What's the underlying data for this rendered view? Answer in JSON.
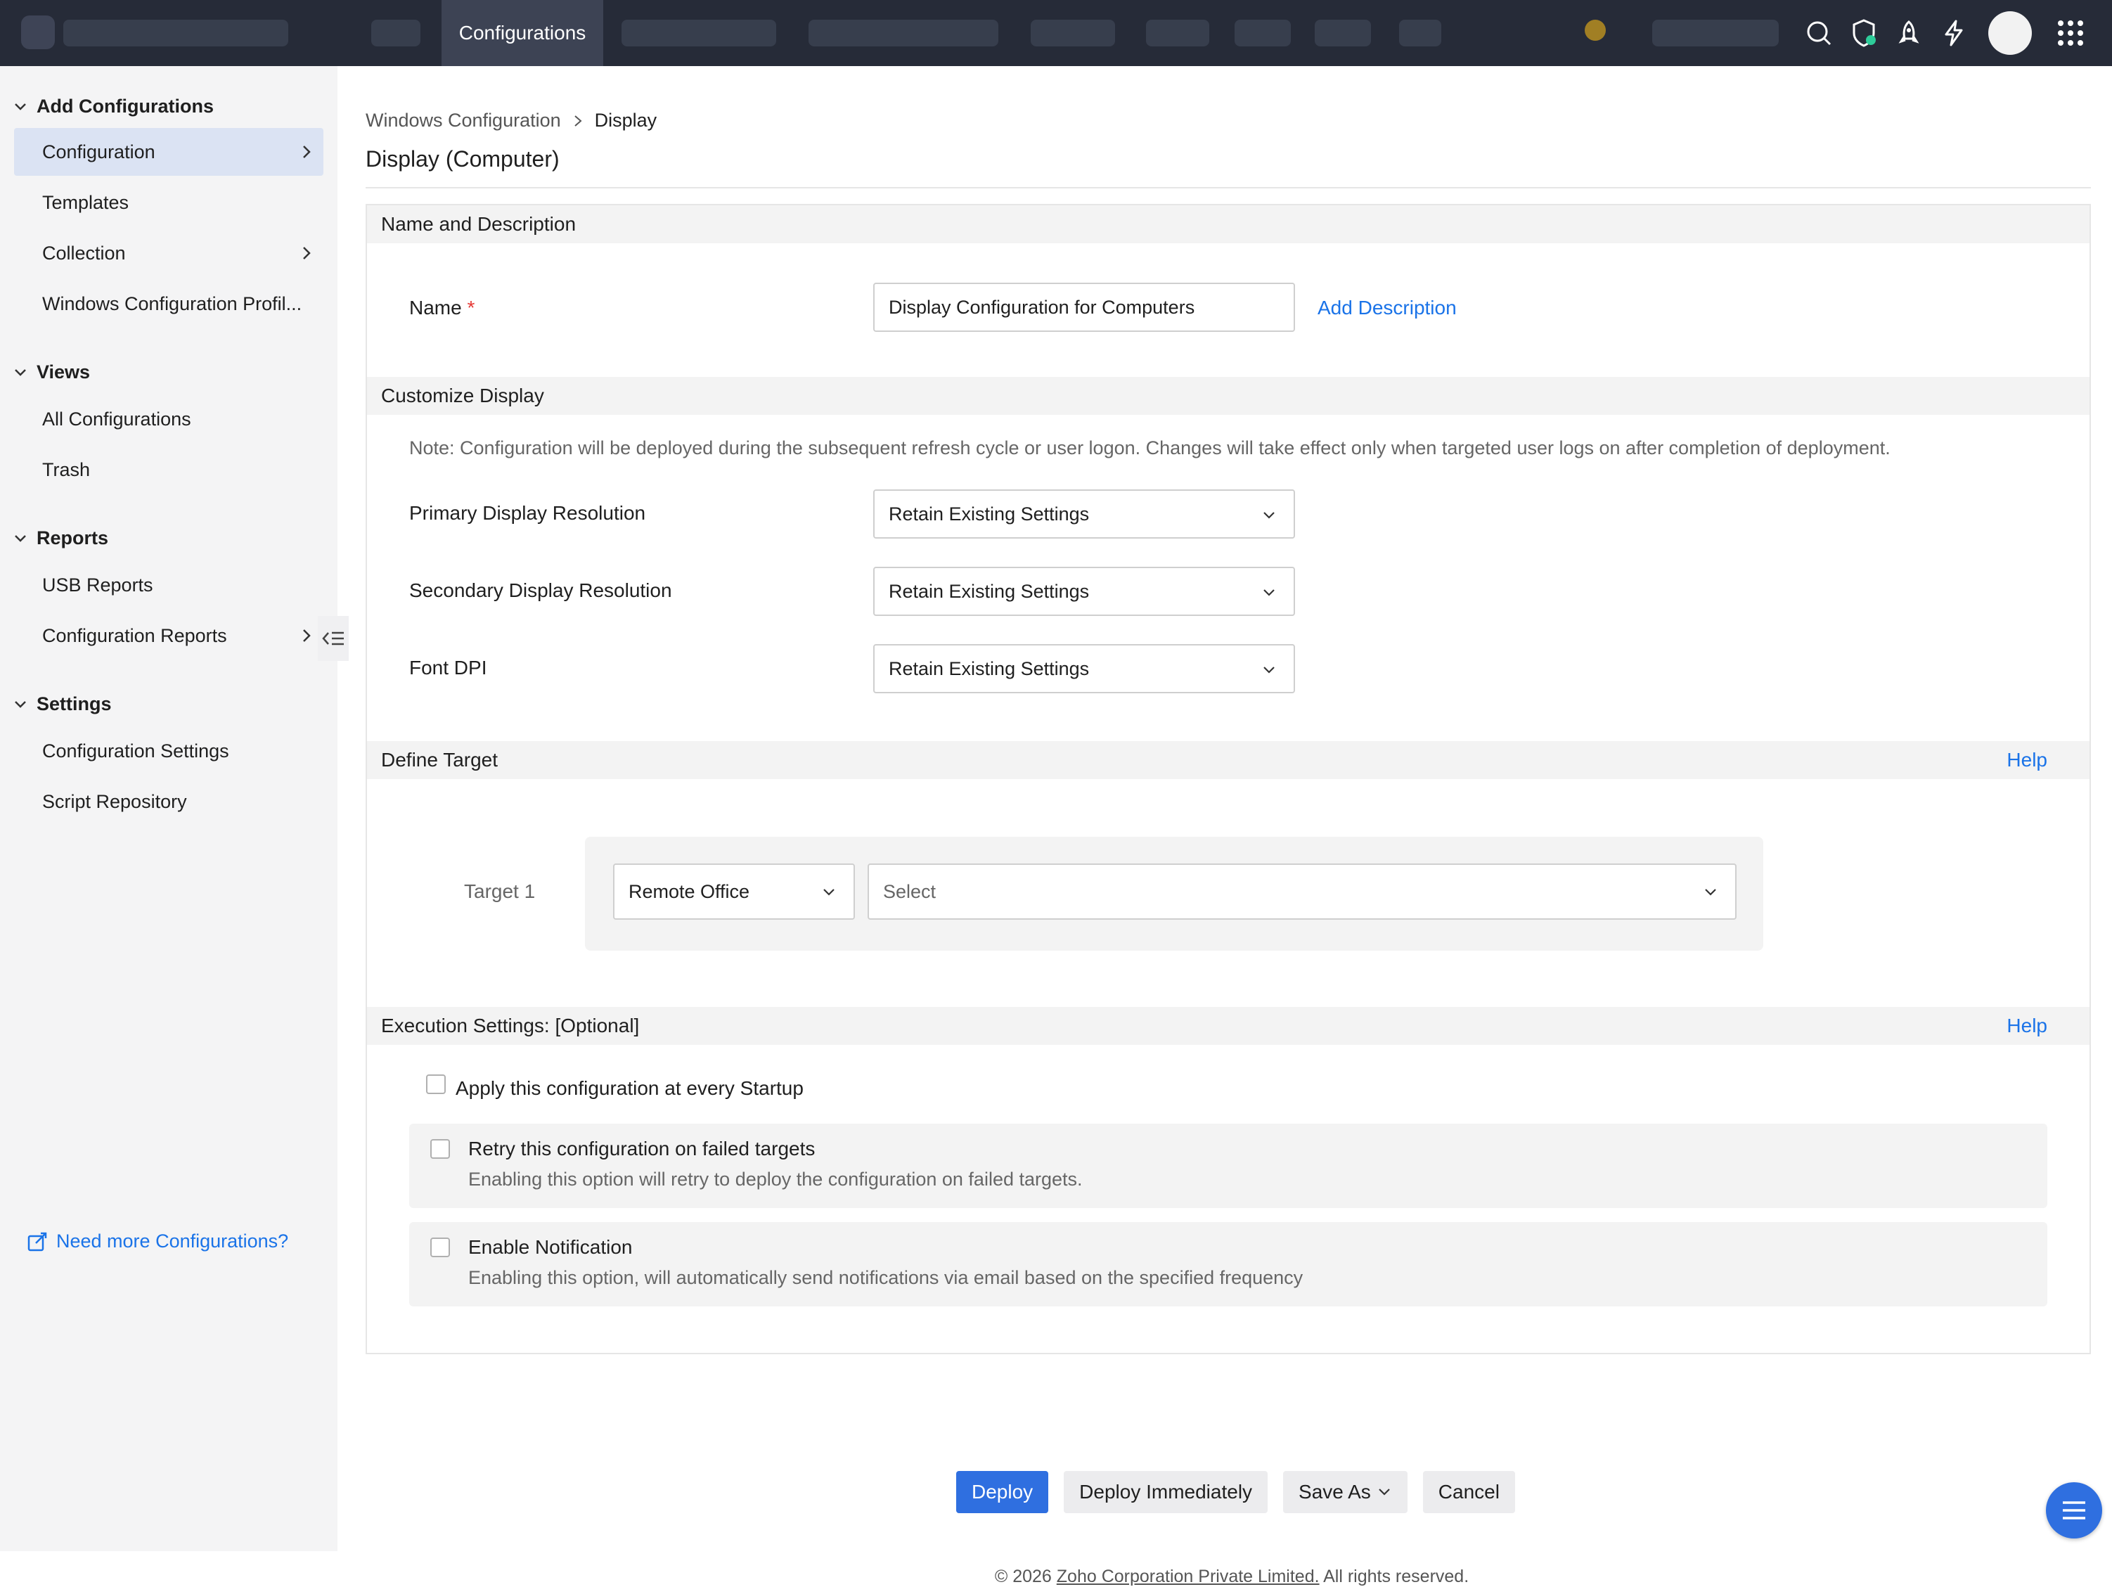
{
  "topbar": {
    "active_tab": "Configurations"
  },
  "sidebar": {
    "sections": [
      {
        "title": "Add Configurations",
        "items": [
          {
            "label": "Configuration"
          },
          {
            "label": "Templates"
          },
          {
            "label": "Collection"
          },
          {
            "label": "Windows Configuration Profil..."
          }
        ]
      },
      {
        "title": "Views",
        "items": [
          {
            "label": "All Configurations"
          },
          {
            "label": "Trash"
          }
        ]
      },
      {
        "title": "Reports",
        "items": [
          {
            "label": "USB Reports"
          },
          {
            "label": "Configuration Reports"
          }
        ]
      },
      {
        "title": "Settings",
        "items": [
          {
            "label": "Configuration Settings"
          },
          {
            "label": "Script Repository"
          }
        ]
      }
    ],
    "need_more": "Need more Configurations?"
  },
  "breadcrumb": {
    "parent": "Windows Configuration",
    "current": "Display"
  },
  "page_title": "Display (Computer)",
  "form": {
    "name_section": {
      "title": "Name and Description",
      "name_label": "Name",
      "required_mark": "*",
      "name_value": "Display Configuration for Computers",
      "add_description": "Add Description"
    },
    "customize_section": {
      "title": "Customize Display",
      "note": "Note: Configuration will be deployed during the subsequent refresh cycle or user logon. Changes will take effect only when targeted user logs on after completion of deployment.",
      "primary_label": "Primary Display Resolution",
      "primary_value": "Retain Existing Settings",
      "secondary_label": "Secondary Display Resolution",
      "secondary_value": "Retain Existing Settings",
      "fontdpi_label": "Font DPI",
      "fontdpi_value": "Retain Existing Settings"
    },
    "target_section": {
      "title": "Define Target",
      "help": "Help",
      "target_label": "Target 1",
      "target_type": "Remote Office",
      "target_select_placeholder": "Select"
    },
    "execution_section": {
      "title": "Execution Settings: [Optional]",
      "help": "Help",
      "startup_label": "Apply this configuration at every Startup",
      "retry_title": "Retry this configuration on failed targets",
      "retry_desc": "Enabling this option will retry to deploy the configuration on failed targets.",
      "notify_title": "Enable Notification",
      "notify_desc": "Enabling this option, will automatically send notifications via email based on the specified frequency"
    }
  },
  "actions": {
    "deploy": "Deploy",
    "deploy_immediately": "Deploy Immediately",
    "save_as": "Save As",
    "cancel": "Cancel"
  },
  "footer": {
    "prefix": "© 2026 ",
    "corp": "Zoho Corporation Private Limited.",
    "suffix": " All rights reserved."
  },
  "colors": {
    "topbar": "#262b38",
    "accent": "#2f6fe0",
    "link": "#1a73e8",
    "sidebar_active": "#dbe3f3"
  }
}
